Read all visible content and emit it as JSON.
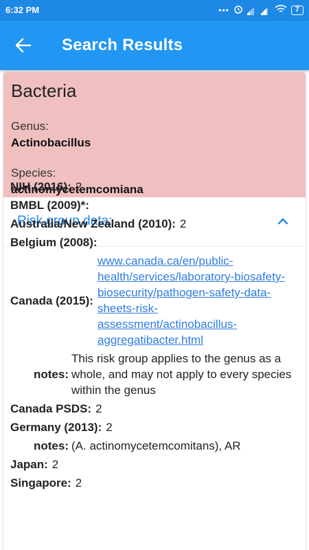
{
  "status_bar": {
    "time": "6:32 PM",
    "battery": "7"
  },
  "app_bar": {
    "title": "Search Results"
  },
  "organism": {
    "kingdom": "Bacteria",
    "genus_label": "Genus:",
    "genus": "Actinobacillus",
    "species_label": "Species:",
    "species": "actinomycetemcomiana"
  },
  "risk_section": {
    "title": "Risk group data:"
  },
  "risk_rows": [
    {
      "label": "NIH (2016):",
      "value": "2"
    },
    {
      "label": "BMBL (2009)*:",
      "value": ""
    },
    {
      "label": "Australia/New Zealand (2010):",
      "value": "2"
    },
    {
      "label": "Belgium (2008):",
      "value": ""
    },
    {
      "label": "Canada (2015):",
      "value": "www.canada.ca/en/public-health/services/laboratory-biosafety-biosecurity/pathogen-safety-data-sheets-risk-assessment/actinobacillus-aggregatibacter.html"
    },
    {
      "label": "notes:",
      "value": "This risk group applies to the genus as a whole, and may not apply to every species within the genus"
    },
    {
      "label": "Canada PSDS:",
      "value": "2"
    },
    {
      "label": "Germany (2013):",
      "value": "2"
    },
    {
      "label": "notes:",
      "value": "(A. actinomycetemcomitans), AR"
    },
    {
      "label": "Japan:",
      "value": "2"
    },
    {
      "label": "Singapore:",
      "value": "2"
    }
  ]
}
